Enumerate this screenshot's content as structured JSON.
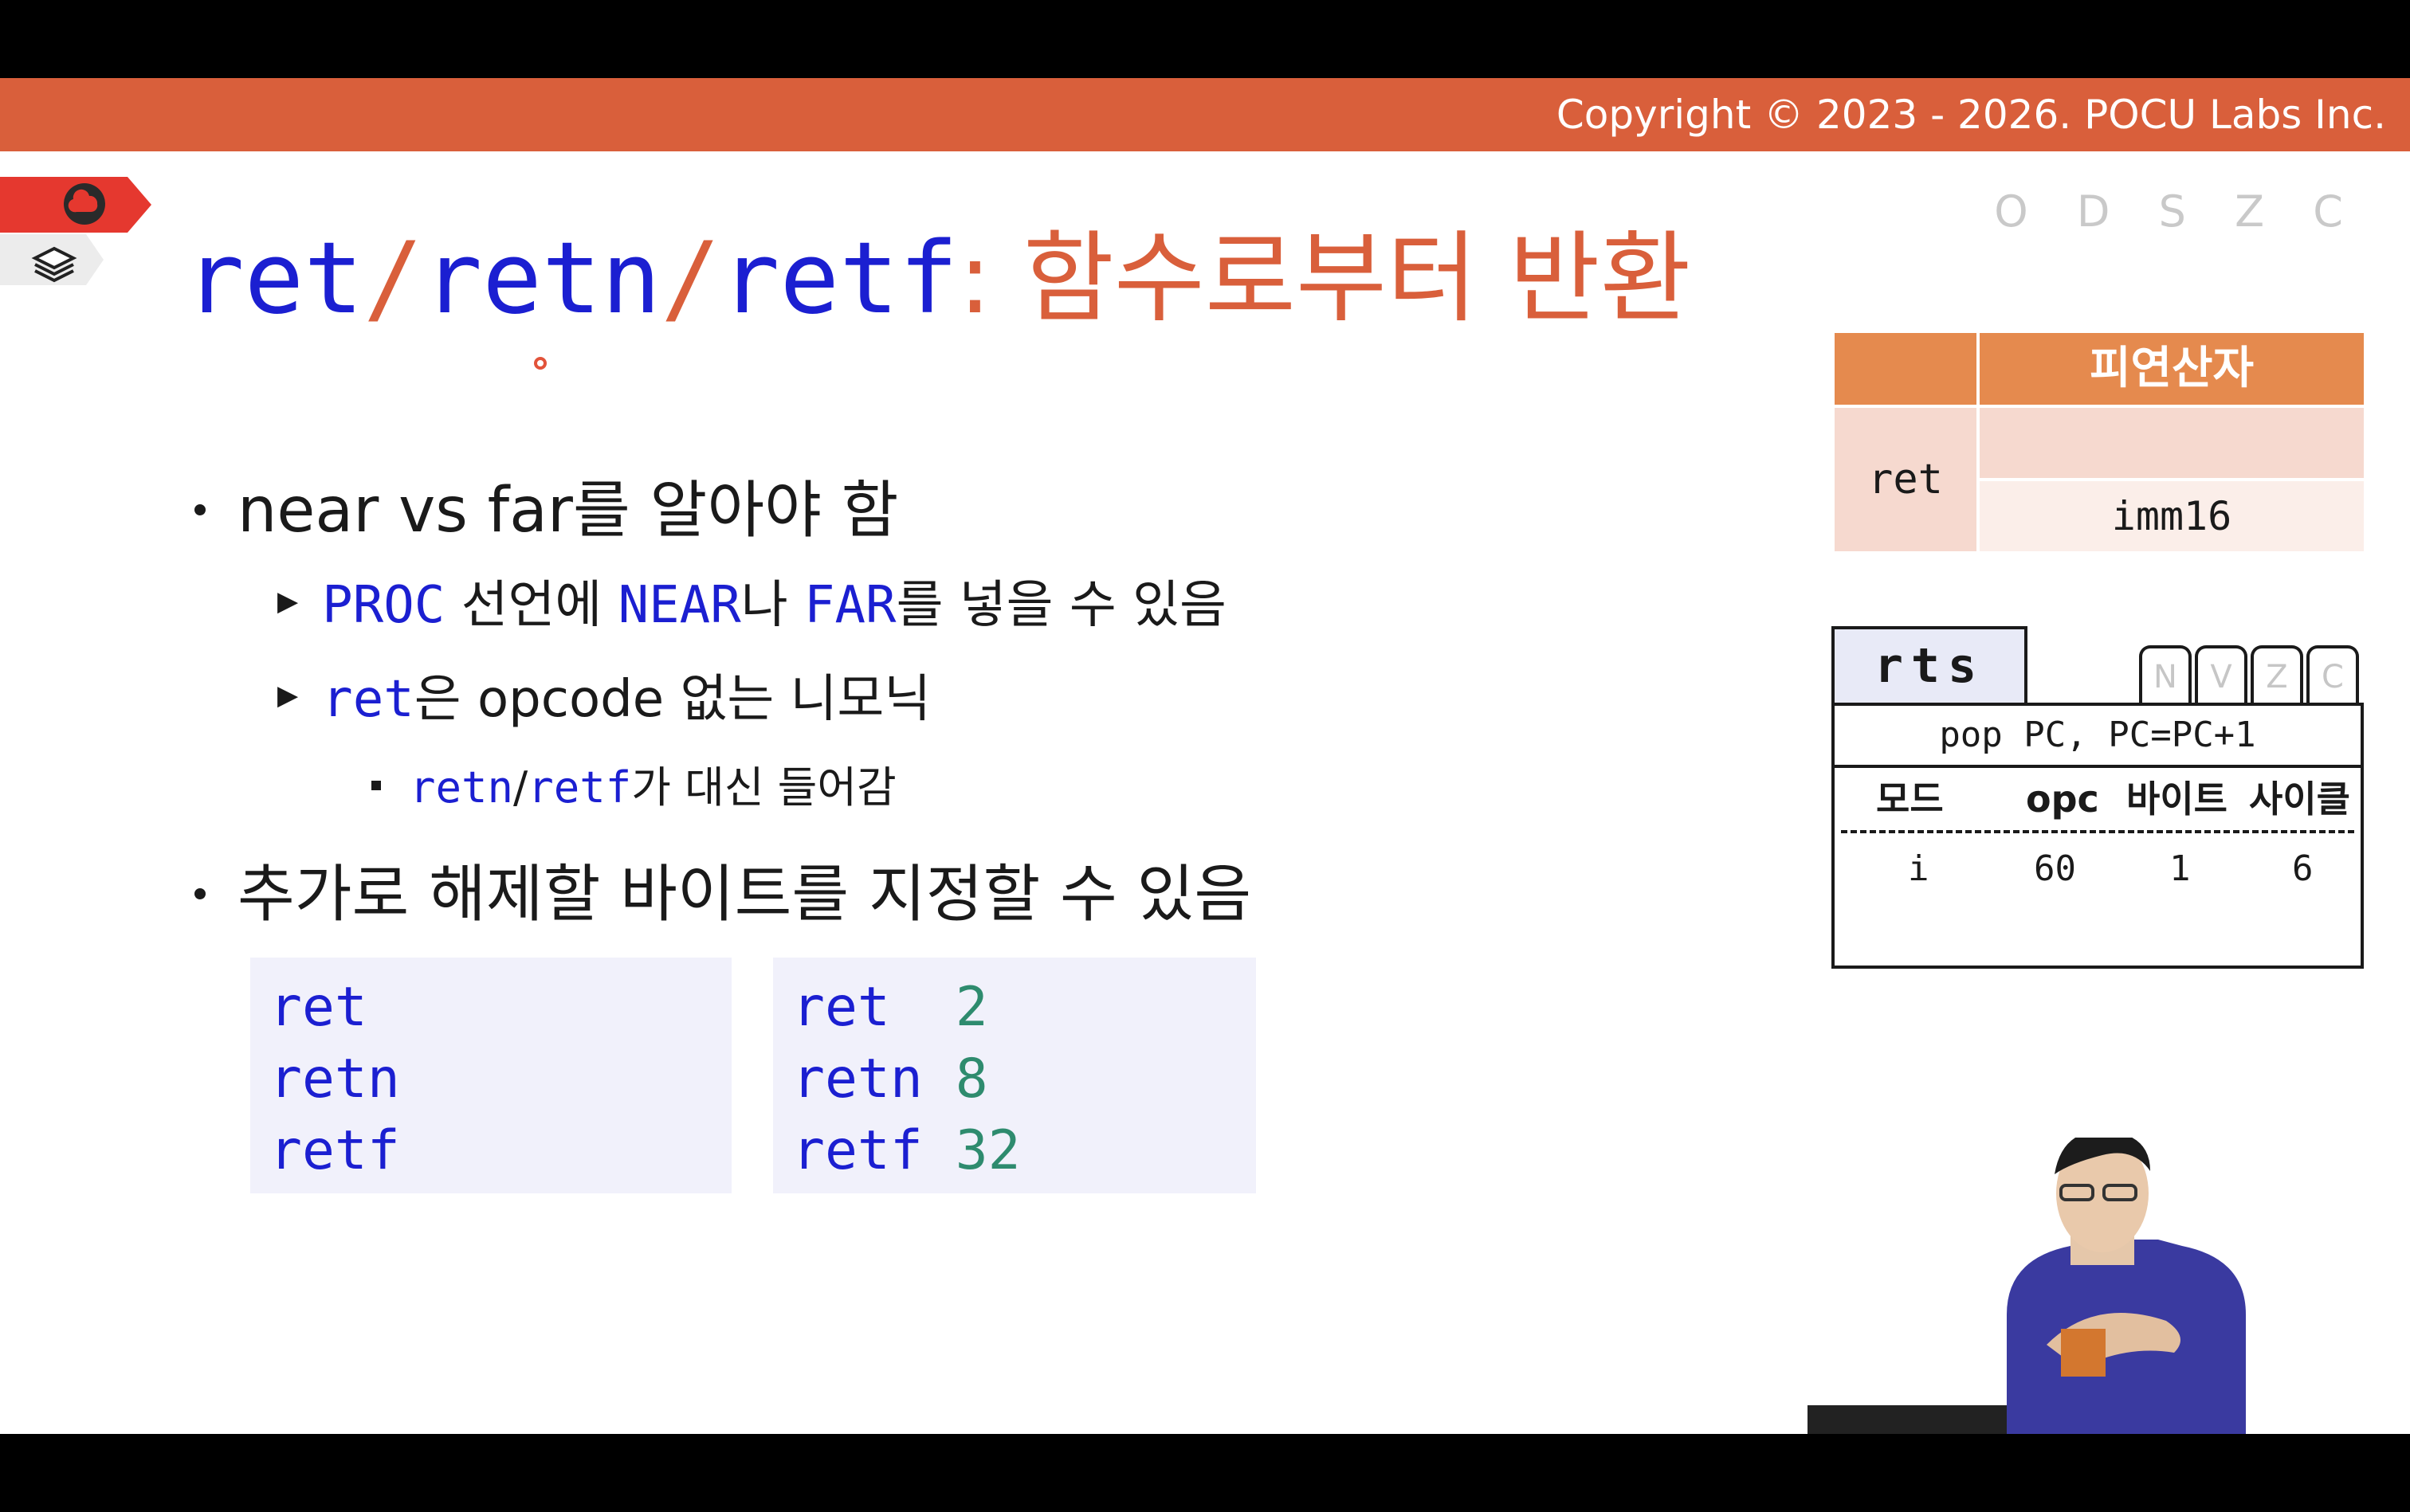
{
  "header": {
    "copyright": "Copyright © 2023 - 2026. POCU Labs Inc."
  },
  "flags_label": "O D S Z C",
  "title": {
    "part1": "ret",
    "slash1": "/",
    "part2": "retn",
    "slash2": "/",
    "part3": "retf",
    "colon": ":",
    "korean": " 함수로부터 반환"
  },
  "bullets": {
    "b1": {
      "text": "near vs far를 알아야 함"
    },
    "b1_1": {
      "kw1": "PROC",
      "t1": " 선언에 ",
      "kw2": "NEAR",
      "t2": "나 ",
      "kw3": "FAR",
      "t3": "를 넣을 수 있음"
    },
    "b1_2": {
      "kw1": "ret",
      "t1": "은 opcode 없는 니모닉"
    },
    "b1_2_1": {
      "kw1": "retn",
      "slash": "/",
      "kw2": "retf",
      "t1": "가 대신 들어감"
    },
    "b2": {
      "text": "추가로 해제할 바이트를 지정할 수 있음"
    }
  },
  "code_left": [
    "ret",
    "retn",
    "retf"
  ],
  "code_right": [
    {
      "kw": "ret  ",
      "num": "2"
    },
    {
      "kw": "retn ",
      "num": "8"
    },
    {
      "kw": "retf ",
      "num": "32"
    }
  ],
  "operand_table": {
    "header": "피연산자",
    "mnemonic": "ret",
    "row1": "",
    "row2": "imm16"
  },
  "rts_card": {
    "name": "rts",
    "flags": [
      "N",
      "V",
      "Z",
      "C"
    ],
    "operation": "pop PC, PC=PC+1",
    "headers": [
      "모드",
      "opc",
      "바이트",
      "사이클"
    ],
    "values": [
      "i",
      "60",
      "1",
      "6"
    ]
  },
  "colors": {
    "accent_orange": "#d95f3b",
    "keyword_blue": "#1b1fd1",
    "number_green": "#2e8b6e"
  }
}
